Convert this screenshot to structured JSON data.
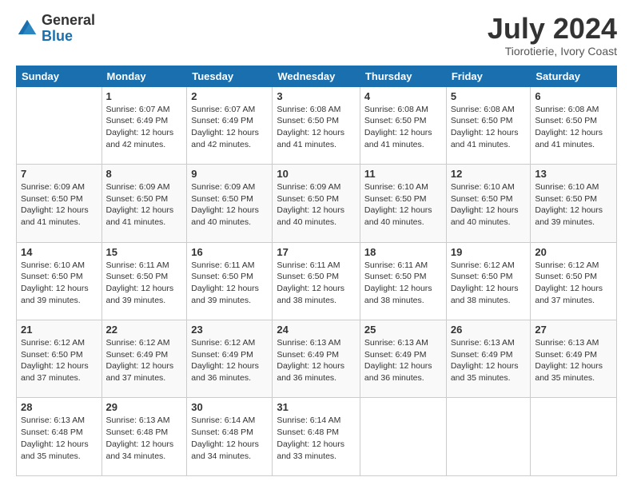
{
  "logo": {
    "line1": "General",
    "line2": "Blue"
  },
  "header": {
    "month_year": "July 2024",
    "location": "Tiorotierie, Ivory Coast"
  },
  "days_of_week": [
    "Sunday",
    "Monday",
    "Tuesday",
    "Wednesday",
    "Thursday",
    "Friday",
    "Saturday"
  ],
  "weeks": [
    [
      {
        "day": "",
        "info": ""
      },
      {
        "day": "1",
        "info": "Sunrise: 6:07 AM\nSunset: 6:49 PM\nDaylight: 12 hours\nand 42 minutes."
      },
      {
        "day": "2",
        "info": "Sunrise: 6:07 AM\nSunset: 6:49 PM\nDaylight: 12 hours\nand 42 minutes."
      },
      {
        "day": "3",
        "info": "Sunrise: 6:08 AM\nSunset: 6:50 PM\nDaylight: 12 hours\nand 41 minutes."
      },
      {
        "day": "4",
        "info": "Sunrise: 6:08 AM\nSunset: 6:50 PM\nDaylight: 12 hours\nand 41 minutes."
      },
      {
        "day": "5",
        "info": "Sunrise: 6:08 AM\nSunset: 6:50 PM\nDaylight: 12 hours\nand 41 minutes."
      },
      {
        "day": "6",
        "info": "Sunrise: 6:08 AM\nSunset: 6:50 PM\nDaylight: 12 hours\nand 41 minutes."
      }
    ],
    [
      {
        "day": "7",
        "info": "Sunrise: 6:09 AM\nSunset: 6:50 PM\nDaylight: 12 hours\nand 41 minutes."
      },
      {
        "day": "8",
        "info": "Sunrise: 6:09 AM\nSunset: 6:50 PM\nDaylight: 12 hours\nand 41 minutes."
      },
      {
        "day": "9",
        "info": "Sunrise: 6:09 AM\nSunset: 6:50 PM\nDaylight: 12 hours\nand 40 minutes."
      },
      {
        "day": "10",
        "info": "Sunrise: 6:09 AM\nSunset: 6:50 PM\nDaylight: 12 hours\nand 40 minutes."
      },
      {
        "day": "11",
        "info": "Sunrise: 6:10 AM\nSunset: 6:50 PM\nDaylight: 12 hours\nand 40 minutes."
      },
      {
        "day": "12",
        "info": "Sunrise: 6:10 AM\nSunset: 6:50 PM\nDaylight: 12 hours\nand 40 minutes."
      },
      {
        "day": "13",
        "info": "Sunrise: 6:10 AM\nSunset: 6:50 PM\nDaylight: 12 hours\nand 39 minutes."
      }
    ],
    [
      {
        "day": "14",
        "info": "Sunrise: 6:10 AM\nSunset: 6:50 PM\nDaylight: 12 hours\nand 39 minutes."
      },
      {
        "day": "15",
        "info": "Sunrise: 6:11 AM\nSunset: 6:50 PM\nDaylight: 12 hours\nand 39 minutes."
      },
      {
        "day": "16",
        "info": "Sunrise: 6:11 AM\nSunset: 6:50 PM\nDaylight: 12 hours\nand 39 minutes."
      },
      {
        "day": "17",
        "info": "Sunrise: 6:11 AM\nSunset: 6:50 PM\nDaylight: 12 hours\nand 38 minutes."
      },
      {
        "day": "18",
        "info": "Sunrise: 6:11 AM\nSunset: 6:50 PM\nDaylight: 12 hours\nand 38 minutes."
      },
      {
        "day": "19",
        "info": "Sunrise: 6:12 AM\nSunset: 6:50 PM\nDaylight: 12 hours\nand 38 minutes."
      },
      {
        "day": "20",
        "info": "Sunrise: 6:12 AM\nSunset: 6:50 PM\nDaylight: 12 hours\nand 37 minutes."
      }
    ],
    [
      {
        "day": "21",
        "info": "Sunrise: 6:12 AM\nSunset: 6:50 PM\nDaylight: 12 hours\nand 37 minutes."
      },
      {
        "day": "22",
        "info": "Sunrise: 6:12 AM\nSunset: 6:49 PM\nDaylight: 12 hours\nand 37 minutes."
      },
      {
        "day": "23",
        "info": "Sunrise: 6:12 AM\nSunset: 6:49 PM\nDaylight: 12 hours\nand 36 minutes."
      },
      {
        "day": "24",
        "info": "Sunrise: 6:13 AM\nSunset: 6:49 PM\nDaylight: 12 hours\nand 36 minutes."
      },
      {
        "day": "25",
        "info": "Sunrise: 6:13 AM\nSunset: 6:49 PM\nDaylight: 12 hours\nand 36 minutes."
      },
      {
        "day": "26",
        "info": "Sunrise: 6:13 AM\nSunset: 6:49 PM\nDaylight: 12 hours\nand 35 minutes."
      },
      {
        "day": "27",
        "info": "Sunrise: 6:13 AM\nSunset: 6:49 PM\nDaylight: 12 hours\nand 35 minutes."
      }
    ],
    [
      {
        "day": "28",
        "info": "Sunrise: 6:13 AM\nSunset: 6:48 PM\nDaylight: 12 hours\nand 35 minutes."
      },
      {
        "day": "29",
        "info": "Sunrise: 6:13 AM\nSunset: 6:48 PM\nDaylight: 12 hours\nand 34 minutes."
      },
      {
        "day": "30",
        "info": "Sunrise: 6:14 AM\nSunset: 6:48 PM\nDaylight: 12 hours\nand 34 minutes."
      },
      {
        "day": "31",
        "info": "Sunrise: 6:14 AM\nSunset: 6:48 PM\nDaylight: 12 hours\nand 33 minutes."
      },
      {
        "day": "",
        "info": ""
      },
      {
        "day": "",
        "info": ""
      },
      {
        "day": "",
        "info": ""
      }
    ]
  ]
}
